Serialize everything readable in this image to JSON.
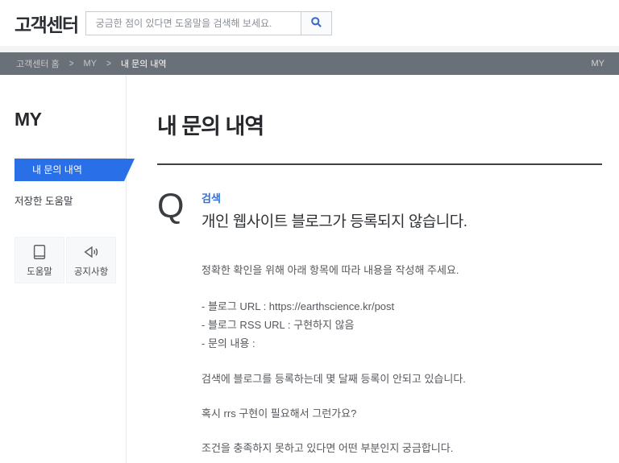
{
  "header": {
    "logo": "고객센터",
    "search_placeholder": "궁금한 점이 있다면 도움말을 검색해 보세요."
  },
  "breadcrumb": {
    "items": [
      "고객센터 홈",
      "MY",
      "내 문의 내역"
    ],
    "separator": ">",
    "right_label": "MY"
  },
  "sidebar": {
    "title": "MY",
    "nav": [
      {
        "label": "내 문의 내역",
        "active": true
      },
      {
        "label": "저장한 도움말",
        "active": false
      }
    ],
    "shortcuts": [
      {
        "label": "도움말",
        "icon": "book-icon"
      },
      {
        "label": "공지사항",
        "icon": "megaphone-icon"
      }
    ]
  },
  "main": {
    "title": "내 문의 내역",
    "question": {
      "marker": "Q",
      "category": "검색",
      "title": "개인 웹사이트 블로그가 등록되지 않습니다.",
      "body": [
        "정확한 확인을 위해 아래 항목에 따라 내용을 작성해 주세요.",
        "- 블로그 URL : https://earthscience.kr/post",
        "- 블로그 RSS URL : 구현하지 않음",
        "- 문의 내용 :",
        "검색에 블로그를 등록하는데 몇 달째 등록이 안되고 있습니다.",
        "혹시 rrs 구현이 필요해서 그런가요?",
        "조건을 충족하지 못하고 있다면 어떤 부분인지 궁금합니다."
      ]
    }
  },
  "colors": {
    "accent_blue": "#2970e8",
    "breadcrumb_bg": "#6a7077",
    "divider_dark": "#3e4146"
  }
}
